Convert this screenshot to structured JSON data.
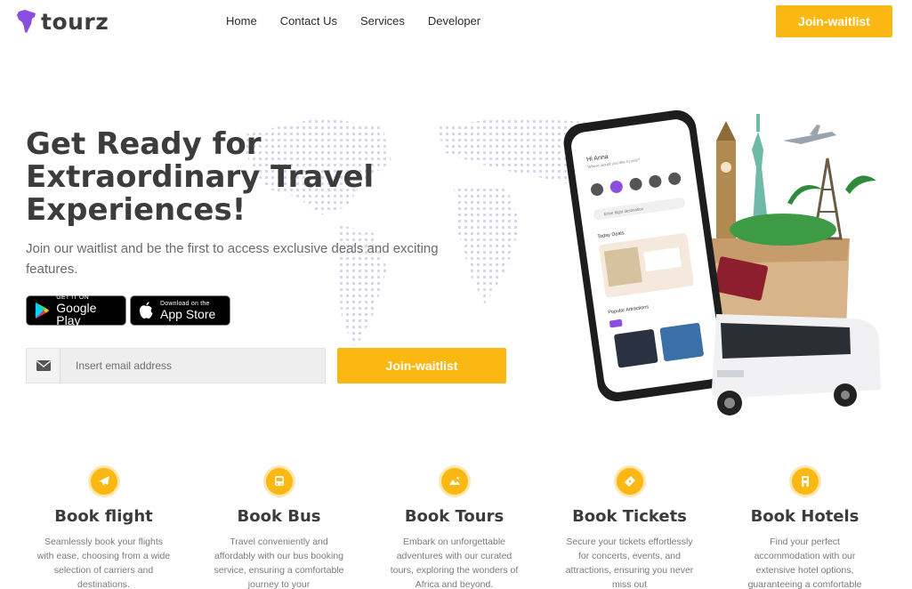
{
  "header": {
    "logo_text": "tourz",
    "nav": [
      "Home",
      "Contact Us",
      "Services",
      "Developer"
    ],
    "cta_label": "Join-waitlist"
  },
  "hero": {
    "title": "Get Ready for Extraordinary Travel Experiences!",
    "subtitle": "Join our waitlist and be the first to access exclusive deals and exciting features.",
    "google_play": {
      "small": "GET IT ON",
      "big": "Google Play"
    },
    "app_store": {
      "small": "Download on the",
      "big": "App Store"
    },
    "email_placeholder": "Insert email address",
    "cta_label": "Join-waitlist"
  },
  "phone": {
    "greeting": "Hi Anna",
    "question": "Where would you like to visit?",
    "categories": [
      "Tours",
      "Flight",
      "Hotels",
      "Bus",
      "Tickets"
    ],
    "search_placeholder": "Enter flight destination",
    "section_deals": "Today Deals",
    "section_popular": "Popular Attractions",
    "popular_tabs": [
      "Lagos",
      "London",
      "Dubai",
      "Abuja"
    ]
  },
  "features": [
    {
      "icon": "airplane-icon",
      "title": "Book flight",
      "desc": "Seamlessly book your flights with ease, choosing from a wide selection of carriers and destinations."
    },
    {
      "icon": "bus-icon",
      "title": "Book Bus",
      "desc": "Travel conveniently and affordably with our bus booking service, ensuring a comfortable journey to your"
    },
    {
      "icon": "tour-icon",
      "title": "Book Tours",
      "desc": "Embark on unforgettable adventures with our curated tours, exploring the wonders of Africa and beyond."
    },
    {
      "icon": "ticket-icon",
      "title": "Book Tickets",
      "desc": "Secure your tickets effortlessly for concerts, events, and attractions, ensuring you never miss out"
    },
    {
      "icon": "hotel-icon",
      "title": "Book Hotels",
      "desc": "Find your perfect accommodation with our extensive hotel options, guaranteeing a comfortable"
    }
  ],
  "colors": {
    "accent": "#fbb812",
    "brand": "#8a4fe0",
    "text": "#3c3c3c"
  }
}
